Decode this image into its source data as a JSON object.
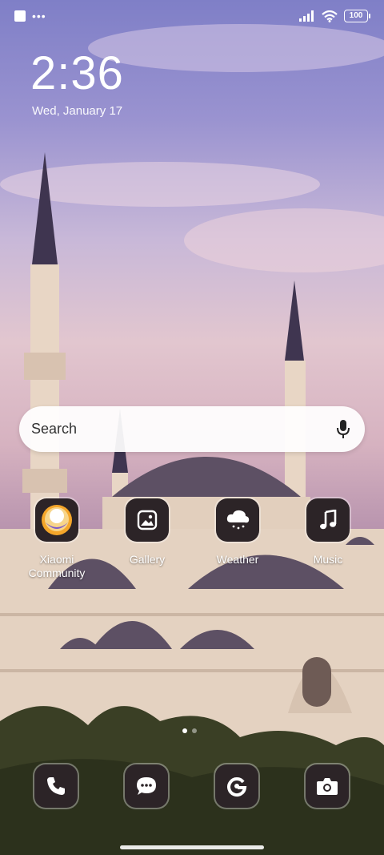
{
  "status_bar": {
    "battery": "100"
  },
  "lock": {
    "time": "2:36",
    "date": "Wed, January 17"
  },
  "search": {
    "placeholder": "Search"
  },
  "apps": [
    {
      "label": "Xiaomi Community",
      "icon": "xiaomi-community-icon"
    },
    {
      "label": "Gallery",
      "icon": "gallery-icon"
    },
    {
      "label": "Weather",
      "icon": "weather-icon"
    },
    {
      "label": "Music",
      "icon": "music-icon"
    }
  ],
  "dock": [
    {
      "icon": "phone-icon"
    },
    {
      "icon": "messages-icon"
    },
    {
      "icon": "browser-icon"
    },
    {
      "icon": "camera-icon"
    }
  ],
  "page_indicator": {
    "current": 1,
    "total": 2
  }
}
